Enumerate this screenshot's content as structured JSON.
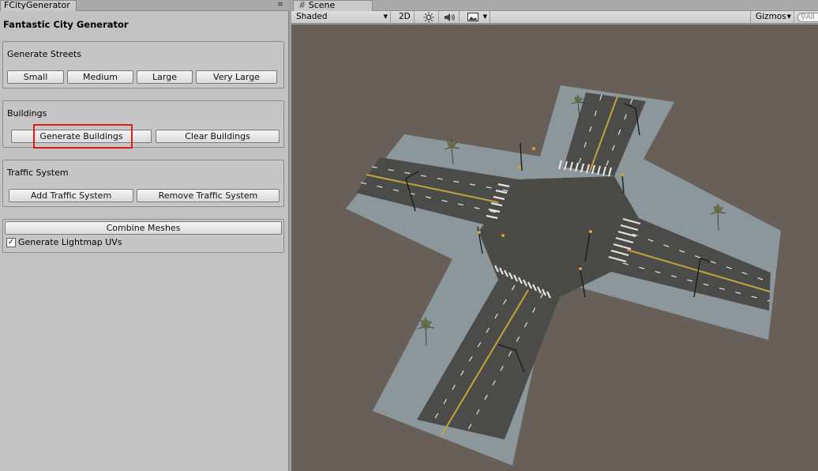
{
  "left_panel": {
    "tab_label": "FCityGenerator",
    "menu_icon": "≡",
    "title": "Fantastic City Generator",
    "streets": {
      "label": "Generate Streets",
      "buttons": [
        "Small",
        "Medium",
        "Large",
        "Very Large"
      ]
    },
    "buildings": {
      "label": "Buildings",
      "generate": "Generate Buildings",
      "clear": "Clear Buildings"
    },
    "traffic": {
      "label": "Traffic System",
      "add": "Add Traffic System",
      "remove": "Remove Traffic System"
    },
    "combine": {
      "button": "Combine Meshes",
      "lightmap_label": "Generate Lightmap UVs",
      "lightmap_checked": true
    }
  },
  "scene": {
    "tab_label": "Scene",
    "tab_icon": "#",
    "shading_mode": "Shaded",
    "mode_2d": "2D",
    "light_icon": "sun-icon",
    "audio_icon": "speaker-icon",
    "effects_icon": "image-icon",
    "gizmos": "Gizmos",
    "search_placeholder": "All"
  },
  "colors": {
    "highlight": "#e01b1b",
    "ground": "#685f58",
    "asphalt": "#4a4b48",
    "sidewalk": "#8c979b",
    "lane_yellow": "#c0a43a"
  }
}
